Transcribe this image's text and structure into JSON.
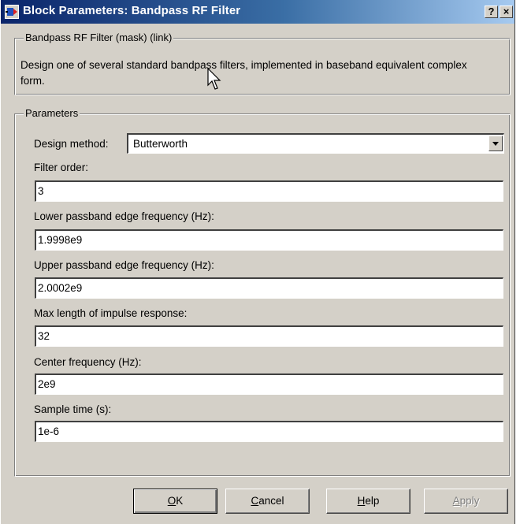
{
  "window": {
    "title": "Block Parameters: Bandpass RF Filter",
    "help_glyph": "?",
    "close_glyph": "×"
  },
  "mask": {
    "legend": "Bandpass RF Filter (mask) (link)",
    "description": "Design one of several standard bandpass filters, implemented in baseband equivalent complex form."
  },
  "parameters": {
    "legend": "Parameters",
    "design_method": {
      "label": "Design method:",
      "value": "Butterworth"
    },
    "filter_order": {
      "label": "Filter order:",
      "value": "3"
    },
    "lower_edge": {
      "label": "Lower passband edge frequency (Hz):",
      "value": "1.9998e9"
    },
    "upper_edge": {
      "label": "Upper passband edge frequency (Hz):",
      "value": "2.0002e9"
    },
    "max_impulse": {
      "label": "Max length of impulse response:",
      "value": "32"
    },
    "center_freq": {
      "label": "Center frequency (Hz):",
      "value": "2e9"
    },
    "sample_time": {
      "label": "Sample time (s):",
      "value": "1e-6"
    }
  },
  "buttons": {
    "ok": {
      "mnemonic": "O",
      "rest": "K"
    },
    "cancel": {
      "mnemonic": "C",
      "rest": "ancel"
    },
    "help": {
      "mnemonic": "H",
      "rest": "elp"
    },
    "apply": {
      "mnemonic": "A",
      "rest": "pply"
    }
  },
  "icons": {
    "app": "simulink-block-icon",
    "pointer": "mouse-pointer-icon",
    "dropdown": "chevron-down-icon"
  },
  "colors": {
    "title_start": "#0a246a",
    "title_end": "#a6caf0",
    "face": "#d4d0c8"
  }
}
